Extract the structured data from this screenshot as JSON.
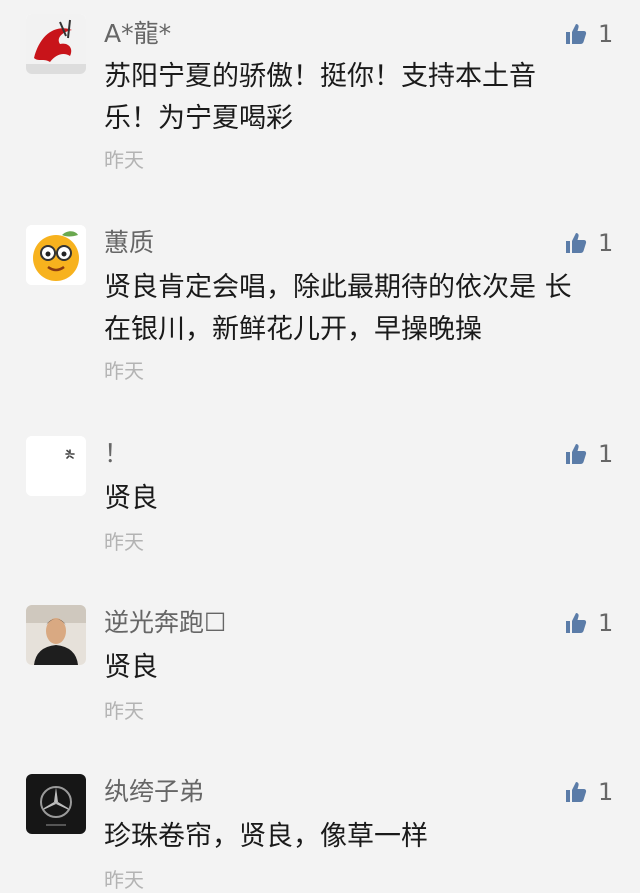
{
  "comments": [
    {
      "name": "A*龍*",
      "lines": [
        "苏阳宁夏的骄傲！挺你！支持本土音",
        "乐！为宁夏喝彩"
      ],
      "time": "昨天",
      "likes": "1",
      "avatar_icon": "red-dragon-icon"
    },
    {
      "name": "蕙质",
      "lines": [
        "贤良肯定会唱，除此最期待的依次是 长",
        "在银川，新鲜花儿开，早操晚操"
      ],
      "time": "昨天",
      "likes": "1",
      "avatar_icon": "orange-face-icon"
    },
    {
      "name": "！",
      "lines": [
        "贤良"
      ],
      "time": "昨天",
      "likes": "1",
      "avatar_icon": "loading-spinner-icon"
    },
    {
      "name": "逆光奔跑☐",
      "lines": [
        "贤良"
      ],
      "time": "昨天",
      "likes": "1",
      "avatar_icon": "person-photo-icon"
    },
    {
      "name": "纨绔子弟",
      "lines": [
        "珍珠卷帘，贤良，像草一样"
      ],
      "time": "昨天",
      "likes": "1",
      "avatar_icon": "mercedes-logo-icon"
    }
  ],
  "colors": {
    "background": "#f3f3f3",
    "like_icon": "#5b7ca8",
    "name": "#666666",
    "time": "#b3b3b3"
  }
}
